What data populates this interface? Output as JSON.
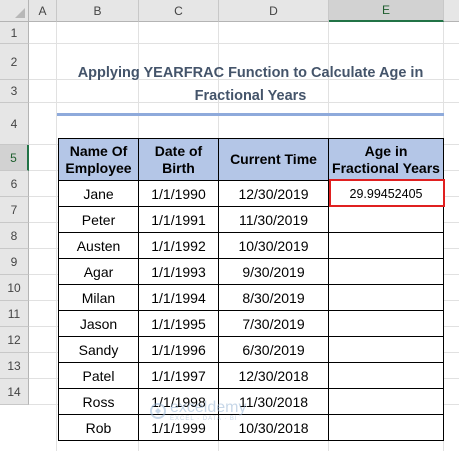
{
  "columns": [
    "A",
    "B",
    "C",
    "D",
    "E"
  ],
  "rows": [
    "1",
    "2",
    "3",
    "4",
    "5",
    "6",
    "7",
    "8",
    "9",
    "10",
    "11",
    "12",
    "13",
    "14"
  ],
  "selected_column": "E",
  "selected_row": "5",
  "title_line1": "Applying YEARFRAC Function to Calculate Age in",
  "title_line2": "Fractional Years",
  "table": {
    "headers": {
      "name": [
        "Name Of",
        "Employee"
      ],
      "dob": [
        "Date of",
        "Birth"
      ],
      "current": [
        "Current Time"
      ],
      "age": [
        "Age in",
        "Fractional Years"
      ]
    },
    "rows": [
      {
        "name": "Jane",
        "dob": "1/1/1990",
        "current": "12/30/2019",
        "age": "29.99452405"
      },
      {
        "name": "Peter",
        "dob": "1/1/1991",
        "current": "11/30/2019",
        "age": ""
      },
      {
        "name": "Austen",
        "dob": "1/1/1992",
        "current": "10/30/2019",
        "age": ""
      },
      {
        "name": "Agar",
        "dob": "1/1/1993",
        "current": "9/30/2019",
        "age": ""
      },
      {
        "name": "Milan",
        "dob": "1/1/1994",
        "current": "8/30/2019",
        "age": ""
      },
      {
        "name": "Jason",
        "dob": "1/1/1995",
        "current": "7/30/2019",
        "age": ""
      },
      {
        "name": "Sandy",
        "dob": "1/1/1996",
        "current": "6/30/2019",
        "age": ""
      },
      {
        "name": "Patel",
        "dob": "1/1/1997",
        "current": "12/30/2018",
        "age": ""
      },
      {
        "name": "Ross",
        "dob": "1/1/1998",
        "current": "11/30/2018",
        "age": ""
      },
      {
        "name": "Rob",
        "dob": "1/1/1999",
        "current": "10/30/2018",
        "age": ""
      }
    ]
  },
  "watermark": {
    "brand": "exceldemy",
    "tagline": "EXCEL · DATA · BI"
  },
  "colors": {
    "header_fill": "#b4c6e7",
    "title": "#44546a",
    "selection": "#e02020",
    "rule": "#8eaadb"
  }
}
